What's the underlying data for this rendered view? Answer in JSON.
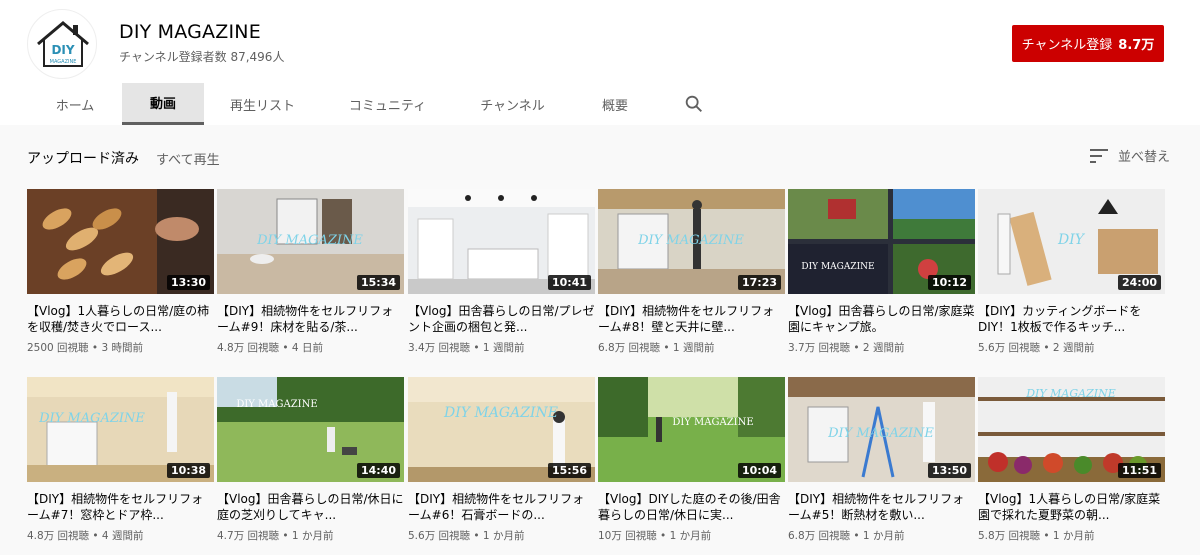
{
  "channel": {
    "name": "DIY MAGAZINE",
    "avatar_text_top": "DIY",
    "avatar_text_bottom": "MAGAZINE",
    "subscribers": "チャンネル登録者数 87,496人",
    "subscribe_label": "チャンネル登録",
    "subscribe_count": "8.7万"
  },
  "tabs": [
    "ホーム",
    "動画",
    "再生リスト",
    "コミュニティ",
    "チャンネル",
    "概要"
  ],
  "active_tab": "動画",
  "section": {
    "title": "アップロード済み",
    "play_all": "すべて再生",
    "sort_label": "並べ替え"
  },
  "videos": [
    {
      "title": "【Vlog】1人暮らしの日常/庭の柿を収穫/焚き火でロース...",
      "views": "2500 回視聴",
      "age": "3 時間前",
      "duration": "13:30",
      "overlay": ""
    },
    {
      "title": "【DIY】相続物件をセルフリフォーム#9！床材を貼る/茶...",
      "views": "4.8万 回視聴",
      "age": "4 日前",
      "duration": "15:34",
      "overlay": "DIY MAGAZINE"
    },
    {
      "title": "【Vlog】田舎暮らしの日常/プレゼント企画の梱包と発...",
      "views": "3.4万 回視聴",
      "age": "1 週間前",
      "duration": "10:41",
      "overlay": ""
    },
    {
      "title": "【DIY】相続物件をセルフリフォーム#8！壁と天井に壁...",
      "views": "6.8万 回視聴",
      "age": "1 週間前",
      "duration": "17:23",
      "overlay": "DIY MAGAZINE"
    },
    {
      "title": "【Vlog】田舎暮らしの日常/家庭菜園にキャンプ旅。",
      "views": "3.7万 回視聴",
      "age": "2 週間前",
      "duration": "10:12",
      "overlay": "DIY MAGAZINE"
    },
    {
      "title": "【DIY】カッティングボードをDIY！1枚板で作るキッチ...",
      "views": "5.6万 回視聴",
      "age": "2 週間前",
      "duration": "24:00",
      "overlay": "DIY"
    },
    {
      "title": "【DIY】相続物件をセルフリフォーム#7！窓枠とドア枠...",
      "views": "4.8万 回視聴",
      "age": "4 週間前",
      "duration": "10:38",
      "overlay": "DIY MAGAZINE"
    },
    {
      "title": "【Vlog】田舎暮らしの日常/休日に庭の芝刈りしてキャ...",
      "views": "4.7万 回視聴",
      "age": "1 か月前",
      "duration": "14:40",
      "overlay": "DIY MAGAZINE"
    },
    {
      "title": "【DIY】相続物件をセルフリフォーム#6！石膏ボードの...",
      "views": "5.6万 回視聴",
      "age": "1 か月前",
      "duration": "15:56",
      "overlay": "DIY MAGAZINE"
    },
    {
      "title": "【Vlog】DIYした庭のその後/田舎暮らしの日常/休日に実...",
      "views": "10万 回視聴",
      "age": "1 か月前",
      "duration": "10:04",
      "overlay": "DIY MAGAZINE"
    },
    {
      "title": "【DIY】相続物件をセルフリフォーム#5！断熱材を敷い...",
      "views": "6.8万 回視聴",
      "age": "1 か月前",
      "duration": "13:50",
      "overlay": "DIY MAGAZINE"
    },
    {
      "title": "【Vlog】1人暮らしの日常/家庭菜園で採れた夏野菜の朝...",
      "views": "5.8万 回視聴",
      "age": "1 か月前",
      "duration": "11:51",
      "overlay": "DIY MAGAZINE"
    }
  ],
  "colors": {
    "subscribe": "#cc0000",
    "overlay_text": "#7fd3e8"
  }
}
